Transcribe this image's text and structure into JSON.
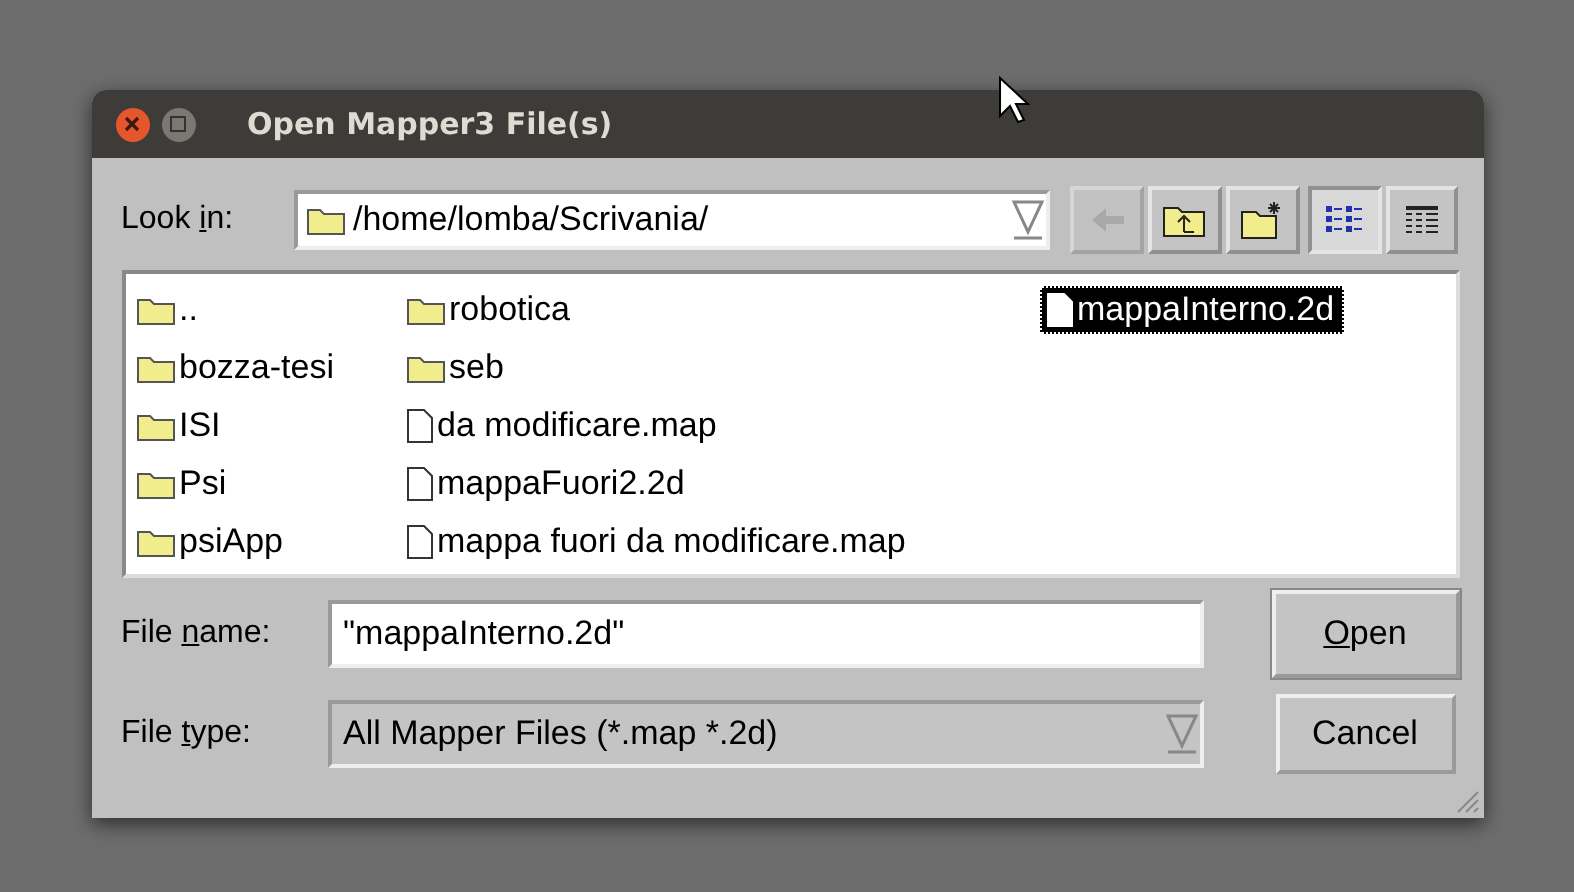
{
  "window": {
    "title": "Open Mapper3 File(s)"
  },
  "look_in": {
    "label": [
      {
        "text": "Look ",
        "underlined": false
      },
      {
        "text": "i",
        "underlined": true
      },
      {
        "text": "n:",
        "underlined": false
      }
    ],
    "value": "/home/lomba/Scrivania/"
  },
  "toolbar": [
    {
      "kind": "back",
      "disabled": true,
      "selected": false
    },
    {
      "kind": "up",
      "disabled": false,
      "selected": false
    },
    {
      "kind": "new-folder",
      "disabled": false,
      "selected": false
    },
    {
      "kind": "list-view",
      "disabled": false,
      "selected": true
    },
    {
      "kind": "detail-view",
      "disabled": false,
      "selected": false
    }
  ],
  "files": [
    {
      "name": "..",
      "kind": "folder",
      "selected": false
    },
    {
      "name": "bozza-tesi",
      "kind": "folder",
      "selected": false
    },
    {
      "name": "ISI",
      "kind": "folder",
      "selected": false
    },
    {
      "name": "Psi",
      "kind": "folder",
      "selected": false
    },
    {
      "name": "psiApp",
      "kind": "folder",
      "selected": false
    },
    {
      "name": "robotica",
      "kind": "folder",
      "selected": false
    },
    {
      "name": "seb",
      "kind": "folder",
      "selected": false
    },
    {
      "name": "da modificare.map",
      "kind": "file",
      "selected": false
    },
    {
      "name": "mappaFuori2.2d",
      "kind": "file",
      "selected": false
    },
    {
      "name": "mappa fuori da modificare.map",
      "kind": "file",
      "selected": false
    },
    {
      "name": "mappaInterno.2d",
      "kind": "file",
      "selected": true
    }
  ],
  "file_name": {
    "label": [
      {
        "text": "File ",
        "underlined": false
      },
      {
        "text": "n",
        "underlined": true
      },
      {
        "text": "ame:",
        "underlined": false
      }
    ],
    "value": "\"mappaInterno.2d\""
  },
  "file_type": {
    "label": [
      {
        "text": "File ",
        "underlined": false
      },
      {
        "text": "t",
        "underlined": true
      },
      {
        "text": "ype:",
        "underlined": false
      }
    ],
    "value": "All Mapper Files (*.map *.2d)"
  },
  "buttons": [
    {
      "label": [
        {
          "text": "O",
          "underlined": true
        },
        {
          "text": "pen",
          "underlined": false
        }
      ],
      "default": true
    },
    {
      "label": [
        {
          "text": "Cancel",
          "underlined": false
        }
      ],
      "default": false
    }
  ]
}
